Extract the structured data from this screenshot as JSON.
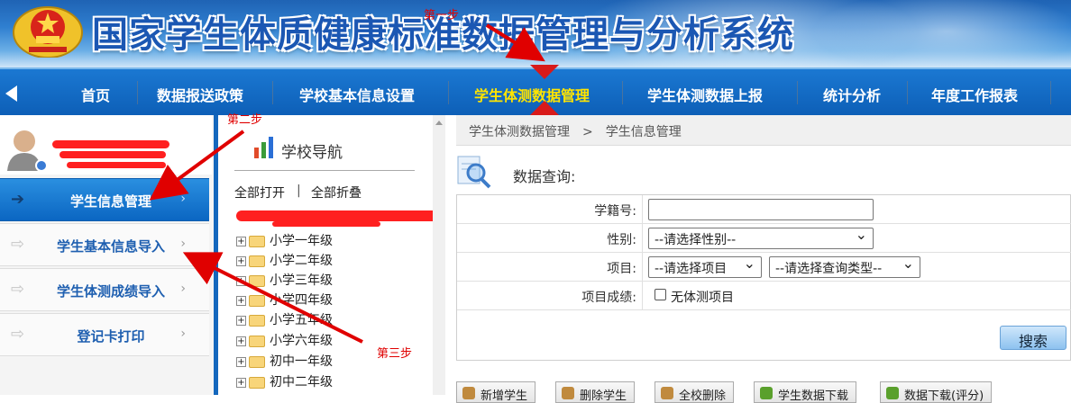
{
  "header": {
    "title": "国家学生体质健康标准数据管理与分析系统"
  },
  "navbar": {
    "items": [
      {
        "label": "首页"
      },
      {
        "label": "数据报送政策"
      },
      {
        "label": "学校基本信息设置"
      },
      {
        "label": "学生体测数据管理",
        "active": true
      },
      {
        "label": "学生体测数据上报"
      },
      {
        "label": "统计分析"
      },
      {
        "label": "年度工作报表"
      }
    ]
  },
  "sidebar": {
    "items": [
      {
        "label": "学生信息管理",
        "active": true
      },
      {
        "label": "学生基本信息导入"
      },
      {
        "label": "学生体测成绩导入"
      },
      {
        "label": "登记卡打印"
      }
    ]
  },
  "tree": {
    "title": "学校导航",
    "expand_all": "全部打开",
    "divider": "|",
    "collapse_all": "全部折叠",
    "nodes": [
      "小学一年级",
      "小学二年级",
      "小学三年级",
      "小学四年级",
      "小学五年级",
      "小学六年级",
      "初中一年级",
      "初中二年级"
    ]
  },
  "main": {
    "breadcrumb": [
      "学生体测数据管理",
      ">",
      "学生信息管理"
    ],
    "query_title": "数据查询:",
    "form": {
      "student_id_label": "学籍号:",
      "student_id_value": "",
      "gender_label": "性别:",
      "gender_value": "--请选择性别--",
      "item_label": "项目:",
      "item_value": "--请选择项目",
      "query_type_value": "--请选择查询类型--",
      "score_label": "项目成绩:",
      "no_test_label": "无体测项目"
    },
    "search_label": "搜索",
    "toolbar": [
      "新增学生",
      "删除学生",
      "全校删除",
      "学生数据下载",
      "数据下载(评分)"
    ]
  },
  "annotations": {
    "step1": "第一步",
    "step2": "第二步",
    "step3": "第三步"
  },
  "colors": {
    "nav_bg": "#0d5fb7",
    "nav_active": "#ffe400",
    "sidebar_active": "#0b66c2",
    "annotation": "#e00000"
  }
}
